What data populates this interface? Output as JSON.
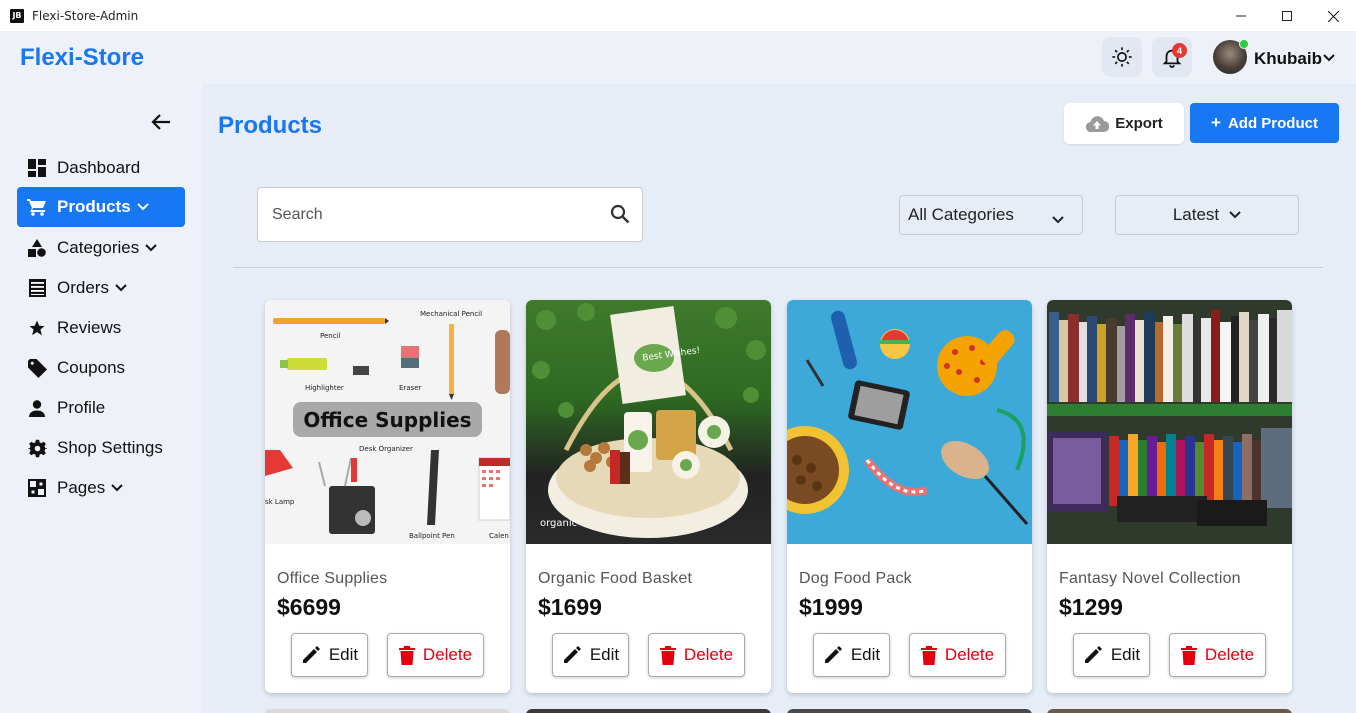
{
  "window": {
    "app_icon_text": "JB",
    "title": "Flexi-Store-Admin"
  },
  "header": {
    "brand": "Flexi-Store",
    "notification_count": "4",
    "user_name": "Khubaib"
  },
  "sidebar": {
    "items": [
      {
        "label": "Dashboard",
        "icon": "dashboard-icon"
      },
      {
        "label": "Products",
        "icon": "cart-icon",
        "active": true,
        "expandable": true
      },
      {
        "label": "Categories",
        "icon": "shapes-icon",
        "expandable": true
      },
      {
        "label": "Orders",
        "icon": "list-icon",
        "expandable": true
      },
      {
        "label": "Reviews",
        "icon": "star-icon"
      },
      {
        "label": "Coupons",
        "icon": "tag-icon"
      },
      {
        "label": "Profile",
        "icon": "person-icon"
      },
      {
        "label": "Shop Settings",
        "icon": "gear-icon"
      },
      {
        "label": "Pages",
        "icon": "pages-icon",
        "expandable": true
      }
    ]
  },
  "main": {
    "title": "Products",
    "export_label": "Export",
    "add_label": "Add Product",
    "search_placeholder": "Search",
    "category_filter": "All Categories",
    "sort": "Latest"
  },
  "products": [
    {
      "name": "Office Supplies",
      "price": "$6699",
      "image_text": {
        "banner": "Office Supplies",
        "labels": [
          "Pencil",
          "Mechanical Pencil",
          "Highlighter",
          "Eraser",
          "Desk Organizer",
          "sk Lamp",
          "Ballpoint Pen",
          "Calen"
        ]
      }
    },
    {
      "name": "Organic Food Basket",
      "price": "$1699",
      "image_text": {
        "card": "Best Wishes!",
        "brand": "organic"
      }
    },
    {
      "name": "Dog Food Pack",
      "price": "$1999"
    },
    {
      "name": "Fantasy Novel Collection",
      "price": "$1299"
    }
  ],
  "card_actions": {
    "edit_label": "Edit",
    "delete_label": "Delete"
  },
  "colors": {
    "accent": "#1877f2",
    "danger": "#e3000f",
    "badge": "#e53935",
    "online": "#2ecc40"
  }
}
